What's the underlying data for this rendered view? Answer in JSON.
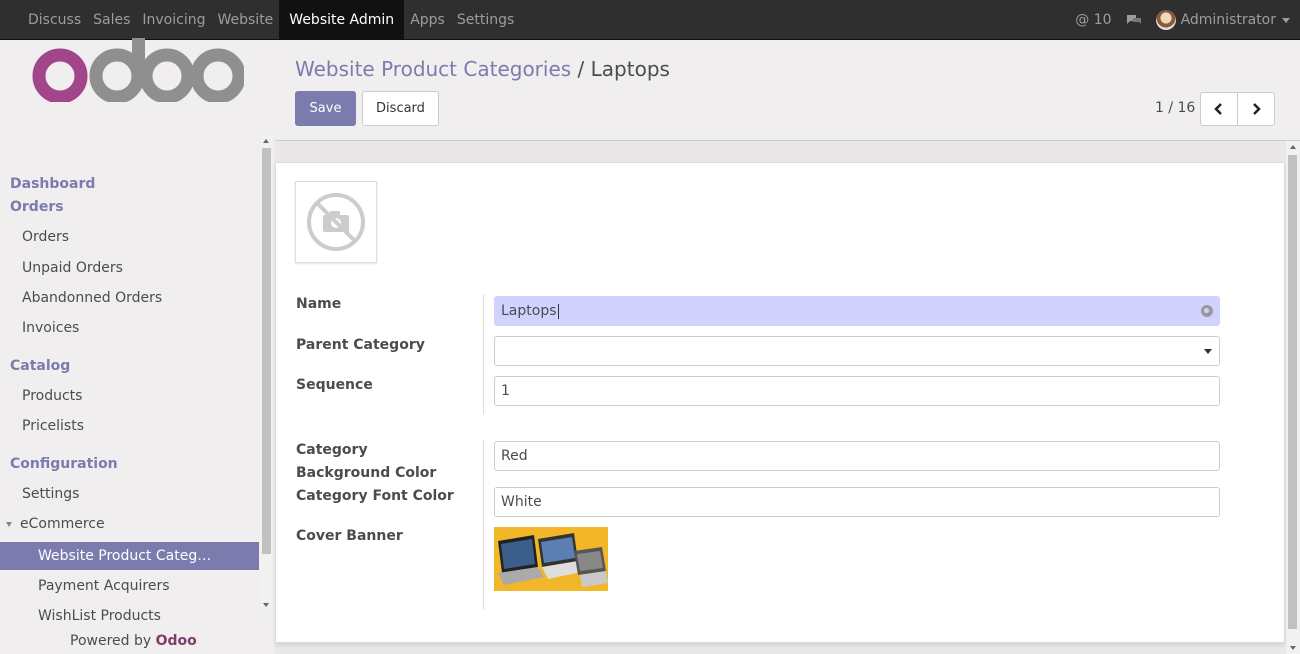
{
  "topbar": {
    "menu": [
      "Discuss",
      "Sales",
      "Invoicing",
      "Website",
      "Website Admin",
      "Apps",
      "Settings"
    ],
    "active": "Website Admin",
    "notifications": "@ 10",
    "user": "Administrator"
  },
  "sidebar": {
    "logo": "odoo",
    "dashboard": "Dashboard",
    "orders_header": "Orders",
    "orders_items": [
      "Orders",
      "Unpaid Orders",
      "Abandonned Orders",
      "Invoices"
    ],
    "catalog_header": "Catalog",
    "catalog_items": [
      "Products",
      "Pricelists"
    ],
    "config_header": "Configuration",
    "config_items": [
      "Settings"
    ],
    "ecommerce": "eCommerce",
    "ecommerce_items": [
      "Website Product Categ…",
      "Payment Acquirers",
      "WishList Products"
    ],
    "powered_prefix": "Powered by ",
    "powered_brand": "Odoo"
  },
  "control": {
    "breadcrumb_parent": "Website Product Categories",
    "breadcrumb_sep": " / ",
    "breadcrumb_current": "Laptops",
    "save": "Save",
    "discard": "Discard",
    "pager": "1 / 16"
  },
  "form": {
    "name_label": "Name",
    "name_value": "Laptops",
    "parent_label": "Parent Category",
    "parent_value": "",
    "sequence_label": "Sequence",
    "sequence_value": "1",
    "bg_color_label_1": "Category",
    "bg_color_label_2": "Background Color",
    "bg_color_value": "Red",
    "font_color_label": "Category Font Color",
    "font_color_value": "White",
    "banner_label": "Cover Banner"
  },
  "colors": {
    "brand": "#7c7bad",
    "navbar": "#2f2f2f",
    "required_field": "#d2d2ff",
    "logo_o": "#a24689",
    "logo_doo": "#8f8f8f"
  }
}
